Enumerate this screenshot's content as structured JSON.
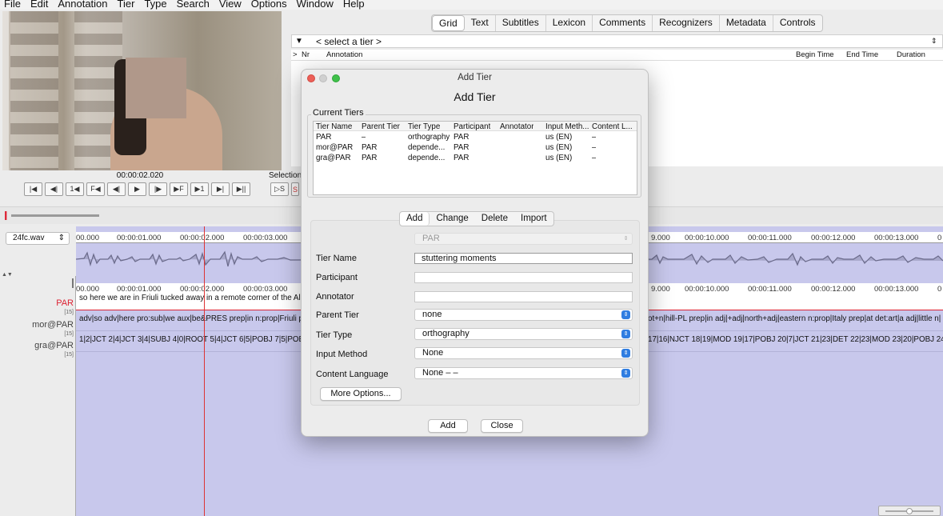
{
  "menubar": [
    "File",
    "Edit",
    "Annotation",
    "Tier",
    "Type",
    "Search",
    "View",
    "Options",
    "Window",
    "Help"
  ],
  "player": {
    "timecode": "00:00:02.020",
    "selection_label": "Selection:"
  },
  "transport": [
    "|◀",
    "◀|",
    "1◀",
    "F◀",
    "◀|",
    "▶",
    "|▶",
    "▶F",
    "▶1",
    "▶|",
    "▶||"
  ],
  "transport2": [
    "▷S",
    "S"
  ],
  "tabs": [
    "Grid",
    "Text",
    "Subtitles",
    "Lexicon",
    "Comments",
    "Recognizers",
    "Metadata",
    "Controls"
  ],
  "grid": {
    "tier_select": "< select a tier >",
    "columns": {
      "arrow": ">",
      "nr": "Nr",
      "annotation": "Annotation",
      "begin": "Begin Time",
      "end": "End Time",
      "duration": "Duration"
    }
  },
  "media": {
    "file": "24fc.wav"
  },
  "ruler": {
    "left": [
      "00.000",
      "00:00:01.000",
      "00:00:02.000",
      "00:00:03.000"
    ],
    "right": [
      "9.000",
      "00:00:10.000",
      "00:00:11.000",
      "00:00:12.000",
      "00:00:13.000",
      "0"
    ]
  },
  "tiers": [
    {
      "name": "PAR",
      "count": "[15]",
      "text_left": "so here we are in Friuli tucked away in a remote corner of the  Alp",
      "text_right": ""
    },
    {
      "name": "mor@PAR",
      "count": "[15]",
      "text_left": "adv|so adv|here pro:sub|we aux|be&PRES prep|in n:prop|Friuli  p",
      "text_right": "ot+n|hill-PL prep|in  adj|+adj|north+adj|eastern n:prop|Italy prep|at det:art|a adj|little  n|"
    },
    {
      "name": "gra@PAR",
      "count": "[15]",
      "text_left": "1|2|JCT 2|4|JCT 3|4|SUBJ 4|0|ROOT 5|4|JCT 6|5|POBJ 7|5|POBJ",
      "text_right": "17|16|NJCT 18|19|MOD 19|17|POBJ 20|7|JCT 21|23|DET 22|23|MOD  23|20|POBJ 24|"
    }
  ],
  "dialog": {
    "window_title": "Add Tier",
    "heading": "Add Tier",
    "current_tiers_label": "Current Tiers",
    "table_headers": [
      "Tier Name",
      "Parent Tier",
      "Tier Type",
      "Participant",
      "Annotator",
      "Input Meth...",
      "Content L..."
    ],
    "table_rows": [
      [
        "PAR",
        "–",
        "orthography",
        "PAR",
        "",
        "us (EN)",
        "–"
      ],
      [
        "mor@PAR",
        "PAR",
        "depende...",
        "PAR",
        "",
        "us (EN)",
        "–"
      ],
      [
        "gra@PAR",
        "PAR",
        "depende...",
        "PAR",
        "",
        "us (EN)",
        "–"
      ]
    ],
    "subtabs": [
      "Add",
      "Change",
      "Delete",
      "Import"
    ],
    "tier_selector": "PAR",
    "fields": {
      "tier_name_label": "Tier Name",
      "tier_name_value": "stuttering moments",
      "participant_label": "Participant",
      "participant_value": "",
      "annotator_label": "Annotator",
      "annotator_value": "",
      "parent_tier_label": "Parent Tier",
      "parent_tier_value": "none",
      "tier_type_label": "Tier Type",
      "tier_type_value": "orthography",
      "input_method_label": "Input Method",
      "input_method_value": "None",
      "content_language_label": "Content Language",
      "content_language_value": "None –  –"
    },
    "more_options": "More Options...",
    "add_button": "Add",
    "close_button": "Close"
  }
}
